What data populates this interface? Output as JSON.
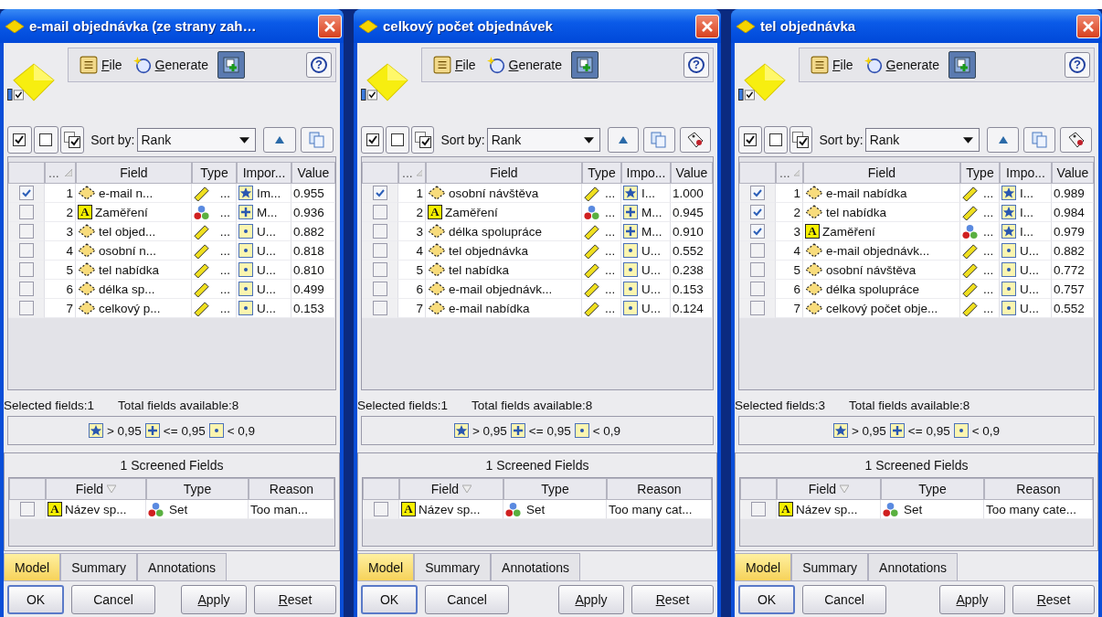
{
  "windows": [
    {
      "title": "e-mail objednávka (ze strany zah…",
      "menu": [
        {
          "label": "File",
          "kind": "file",
          "underline_first": true
        },
        {
          "label": "Generate",
          "kind": "generate",
          "underline_first": true
        }
      ],
      "help": "?",
      "sort_label": "Sort by:",
      "sort_value": "Rank",
      "tools": [
        {
          "kind": "ascending"
        },
        {
          "kind": "copy"
        }
      ],
      "columns": [
        "...",
        "Field",
        "Type",
        "Impor...",
        "Value"
      ],
      "rows": [
        {
          "checked": true,
          "rank": "1",
          "field": {
            "kind": "range",
            "text": "e-mail n..."
          },
          "type": {
            "kind": "range",
            "text": "..."
          },
          "importance": {
            "kind": "important",
            "text": "Im..."
          },
          "value": "0.955"
        },
        {
          "checked": false,
          "rank": "2",
          "field": {
            "kind": "text",
            "badge": "A",
            "text": "Zaměření"
          },
          "type": {
            "kind": "set",
            "text": "..."
          },
          "importance": {
            "kind": "marginal",
            "text": "M..."
          },
          "value": "0.936"
        },
        {
          "checked": false,
          "rank": "3",
          "field": {
            "kind": "range",
            "text": "tel objed..."
          },
          "type": {
            "kind": "range",
            "text": "..."
          },
          "importance": {
            "kind": "unimportant",
            "text": "U..."
          },
          "value": "0.882"
        },
        {
          "checked": false,
          "rank": "4",
          "field": {
            "kind": "range",
            "text": "osobní n..."
          },
          "type": {
            "kind": "range",
            "text": "..."
          },
          "importance": {
            "kind": "unimportant",
            "text": "U..."
          },
          "value": "0.818"
        },
        {
          "checked": false,
          "rank": "5",
          "field": {
            "kind": "range",
            "text": "tel nabídka"
          },
          "type": {
            "kind": "range",
            "text": "..."
          },
          "importance": {
            "kind": "unimportant",
            "text": "U..."
          },
          "value": "0.810"
        },
        {
          "checked": false,
          "rank": "6",
          "field": {
            "kind": "range",
            "text": "délka sp..."
          },
          "type": {
            "kind": "range",
            "text": "..."
          },
          "importance": {
            "kind": "unimportant",
            "text": "U..."
          },
          "value": "0.499"
        },
        {
          "checked": false,
          "rank": "7",
          "field": {
            "kind": "range",
            "text": "celkový p..."
          },
          "type": {
            "kind": "range",
            "text": "..."
          },
          "importance": {
            "kind": "unimportant",
            "text": "U..."
          },
          "value": "0.153"
        }
      ],
      "selected_summary": "Selected fields:1",
      "total_summary": "Total fields available:8",
      "legend": [
        {
          "kind": "important",
          "label": "> 0,95"
        },
        {
          "kind": "marginal",
          "label": "<= 0,95"
        },
        {
          "kind": "unimportant",
          "label": "< 0,9"
        }
      ],
      "screened": {
        "title": "1 Screened Fields",
        "columns": [
          "Field",
          "Type",
          "Reason"
        ],
        "rows": [
          {
            "checked": false,
            "field": {
              "kind": "text",
              "badge": "A",
              "text": "Název sp..."
            },
            "type": {
              "kind": "set",
              "text": "Set"
            },
            "reason": "Too man..."
          }
        ]
      },
      "tabs": [
        {
          "label": "Model",
          "selected": true
        },
        {
          "label": "Summary",
          "selected": false
        },
        {
          "label": "Annotations",
          "selected": false
        }
      ],
      "buttons": [
        {
          "label": "OK",
          "kind": "default",
          "underline_first": false
        },
        {
          "label": "Cancel",
          "kind": "normal",
          "underline_first": false
        },
        {
          "label": "Apply",
          "kind": "normal",
          "underline_first": true
        },
        {
          "label": "Reset",
          "kind": "normal",
          "underline_first": true
        }
      ]
    },
    {
      "title": "celkový počet objednávek",
      "menu": [
        {
          "label": "File",
          "kind": "file",
          "underline_first": true
        },
        {
          "label": "Generate",
          "kind": "generate",
          "underline_first": true
        }
      ],
      "help": "?",
      "sort_label": "Sort by:",
      "sort_value": "Rank",
      "tools": [
        {
          "kind": "ascending"
        },
        {
          "kind": "copy"
        },
        {
          "kind": "tag"
        }
      ],
      "columns": [
        "...",
        "Field",
        "Type",
        "Impo...",
        "Value"
      ],
      "rows": [
        {
          "checked": true,
          "rank": "1",
          "field": {
            "kind": "range",
            "text": "osobní návštěva"
          },
          "type": {
            "kind": "range",
            "text": "..."
          },
          "importance": {
            "kind": "important",
            "text": "I..."
          },
          "value": "1.000"
        },
        {
          "checked": false,
          "rank": "2",
          "field": {
            "kind": "text",
            "badge": "A",
            "text": "Zaměření"
          },
          "type": {
            "kind": "set",
            "text": "..."
          },
          "importance": {
            "kind": "marginal",
            "text": "M..."
          },
          "value": "0.945"
        },
        {
          "checked": false,
          "rank": "3",
          "field": {
            "kind": "range",
            "text": "délka spolupráce"
          },
          "type": {
            "kind": "range",
            "text": "..."
          },
          "importance": {
            "kind": "marginal",
            "text": "M..."
          },
          "value": "0.910"
        },
        {
          "checked": false,
          "rank": "4",
          "field": {
            "kind": "range",
            "text": "tel objednávka"
          },
          "type": {
            "kind": "range",
            "text": "..."
          },
          "importance": {
            "kind": "unimportant",
            "text": "U..."
          },
          "value": "0.552"
        },
        {
          "checked": false,
          "rank": "5",
          "field": {
            "kind": "range",
            "text": "tel nabídka"
          },
          "type": {
            "kind": "range",
            "text": "..."
          },
          "importance": {
            "kind": "unimportant",
            "text": "U..."
          },
          "value": "0.238"
        },
        {
          "checked": false,
          "rank": "6",
          "field": {
            "kind": "range",
            "text": "e-mail objednávk..."
          },
          "type": {
            "kind": "range",
            "text": "..."
          },
          "importance": {
            "kind": "unimportant",
            "text": "U..."
          },
          "value": "0.153"
        },
        {
          "checked": false,
          "rank": "7",
          "field": {
            "kind": "range",
            "text": "e-mail nabídka"
          },
          "type": {
            "kind": "range",
            "text": "..."
          },
          "importance": {
            "kind": "unimportant",
            "text": "U..."
          },
          "value": "0.124"
        }
      ],
      "selected_summary": "Selected fields:1",
      "total_summary": "Total fields available:8",
      "legend": [
        {
          "kind": "important",
          "label": "> 0,95"
        },
        {
          "kind": "marginal",
          "label": "<= 0,95"
        },
        {
          "kind": "unimportant",
          "label": "< 0,9"
        }
      ],
      "screened": {
        "title": "1 Screened Fields",
        "columns": [
          "Field",
          "Type",
          "Reason"
        ],
        "rows": [
          {
            "checked": false,
            "field": {
              "kind": "text",
              "badge": "A",
              "text": "Název sp..."
            },
            "type": {
              "kind": "set",
              "text": "Set"
            },
            "reason": "Too many cat..."
          }
        ]
      },
      "tabs": [
        {
          "label": "Model",
          "selected": true
        },
        {
          "label": "Summary",
          "selected": false
        },
        {
          "label": "Annotations",
          "selected": false
        }
      ],
      "buttons": [
        {
          "label": "OK",
          "kind": "default",
          "underline_first": false
        },
        {
          "label": "Cancel",
          "kind": "normal",
          "underline_first": false
        },
        {
          "label": "Apply",
          "kind": "normal",
          "underline_first": true
        },
        {
          "label": "Reset",
          "kind": "normal",
          "underline_first": true
        }
      ]
    },
    {
      "title": "tel objednávka",
      "menu": [
        {
          "label": "File",
          "kind": "file",
          "underline_first": true
        },
        {
          "label": "Generate",
          "kind": "generate",
          "underline_first": true
        }
      ],
      "help": "?",
      "sort_label": "Sort by:",
      "sort_value": "Rank",
      "tools": [
        {
          "kind": "ascending"
        },
        {
          "kind": "copy"
        },
        {
          "kind": "tag"
        }
      ],
      "columns": [
        "...",
        "Field",
        "Type",
        "Impo...",
        "Value"
      ],
      "rows": [
        {
          "checked": true,
          "rank": "1",
          "field": {
            "kind": "range",
            "text": "e-mail nabídka"
          },
          "type": {
            "kind": "range",
            "text": "..."
          },
          "importance": {
            "kind": "important",
            "text": "I..."
          },
          "value": "0.989"
        },
        {
          "checked": true,
          "rank": "2",
          "field": {
            "kind": "range",
            "text": "tel nabídka"
          },
          "type": {
            "kind": "range",
            "text": "..."
          },
          "importance": {
            "kind": "important",
            "text": "I..."
          },
          "value": "0.984"
        },
        {
          "checked": true,
          "rank": "3",
          "field": {
            "kind": "text",
            "badge": "A",
            "text": "Zaměření"
          },
          "type": {
            "kind": "set",
            "text": "..."
          },
          "importance": {
            "kind": "important",
            "text": "I..."
          },
          "value": "0.979"
        },
        {
          "checked": false,
          "rank": "4",
          "field": {
            "kind": "range",
            "text": "e-mail objednávk..."
          },
          "type": {
            "kind": "range",
            "text": "..."
          },
          "importance": {
            "kind": "unimportant",
            "text": "U..."
          },
          "value": "0.882"
        },
        {
          "checked": false,
          "rank": "5",
          "field": {
            "kind": "range",
            "text": "osobní návštěva"
          },
          "type": {
            "kind": "range",
            "text": "..."
          },
          "importance": {
            "kind": "unimportant",
            "text": "U..."
          },
          "value": "0.772"
        },
        {
          "checked": false,
          "rank": "6",
          "field": {
            "kind": "range",
            "text": "délka spolupráce"
          },
          "type": {
            "kind": "range",
            "text": "..."
          },
          "importance": {
            "kind": "unimportant",
            "text": "U..."
          },
          "value": "0.757"
        },
        {
          "checked": false,
          "rank": "7",
          "field": {
            "kind": "range",
            "text": "celkový počet obje..."
          },
          "type": {
            "kind": "range",
            "text": "..."
          },
          "importance": {
            "kind": "unimportant",
            "text": "U..."
          },
          "value": "0.552"
        }
      ],
      "selected_summary": "Selected fields:3",
      "total_summary": "Total fields available:8",
      "legend": [
        {
          "kind": "important",
          "label": "> 0,95"
        },
        {
          "kind": "marginal",
          "label": "<= 0,95"
        },
        {
          "kind": "unimportant",
          "label": "< 0,9"
        }
      ],
      "screened": {
        "title": "1 Screened Fields",
        "columns": [
          "Field",
          "Type",
          "Reason"
        ],
        "rows": [
          {
            "checked": false,
            "field": {
              "kind": "text",
              "badge": "A",
              "text": "Název sp..."
            },
            "type": {
              "kind": "set",
              "text": "Set"
            },
            "reason": "Too many cate..."
          }
        ]
      },
      "tabs": [
        {
          "label": "Model",
          "selected": true
        },
        {
          "label": "Summary",
          "selected": false
        },
        {
          "label": "Annotations",
          "selected": false
        }
      ],
      "buttons": [
        {
          "label": "OK",
          "kind": "default",
          "underline_first": false
        },
        {
          "label": "Cancel",
          "kind": "normal",
          "underline_first": false
        },
        {
          "label": "Apply",
          "kind": "normal",
          "underline_first": true
        },
        {
          "label": "Reset",
          "kind": "normal",
          "underline_first": true
        }
      ]
    }
  ]
}
